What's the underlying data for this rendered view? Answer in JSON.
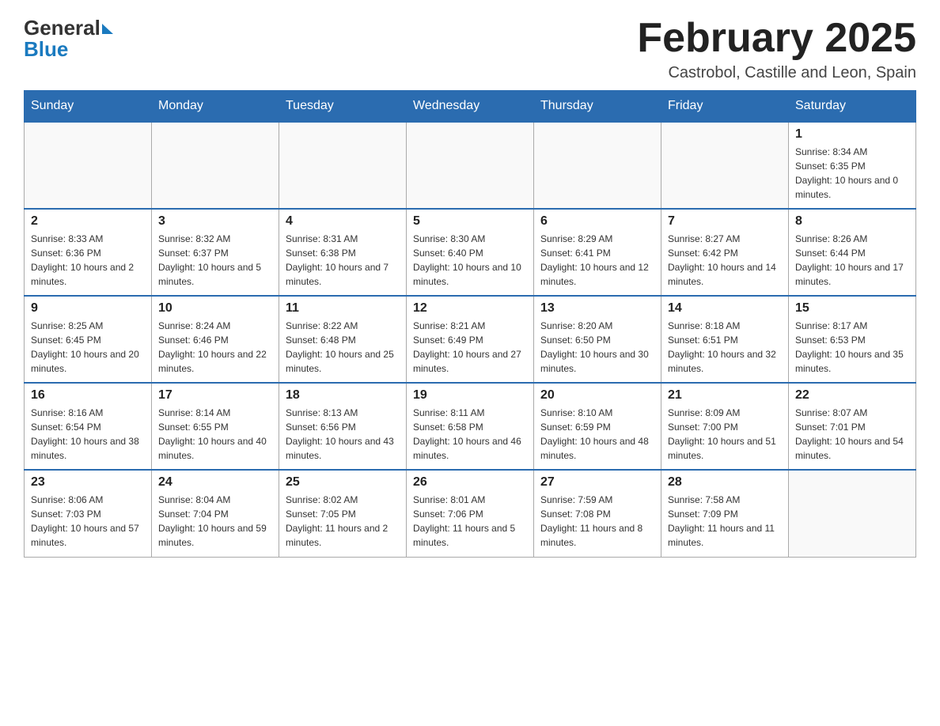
{
  "header": {
    "logo_text_general": "General",
    "logo_text_blue": "Blue",
    "month_title": "February 2025",
    "location": "Castrobol, Castille and Leon, Spain"
  },
  "weekdays": [
    "Sunday",
    "Monday",
    "Tuesday",
    "Wednesday",
    "Thursday",
    "Friday",
    "Saturday"
  ],
  "weeks": [
    [
      {
        "day": "",
        "info": ""
      },
      {
        "day": "",
        "info": ""
      },
      {
        "day": "",
        "info": ""
      },
      {
        "day": "",
        "info": ""
      },
      {
        "day": "",
        "info": ""
      },
      {
        "day": "",
        "info": ""
      },
      {
        "day": "1",
        "info": "Sunrise: 8:34 AM\nSunset: 6:35 PM\nDaylight: 10 hours and 0 minutes."
      }
    ],
    [
      {
        "day": "2",
        "info": "Sunrise: 8:33 AM\nSunset: 6:36 PM\nDaylight: 10 hours and 2 minutes."
      },
      {
        "day": "3",
        "info": "Sunrise: 8:32 AM\nSunset: 6:37 PM\nDaylight: 10 hours and 5 minutes."
      },
      {
        "day": "4",
        "info": "Sunrise: 8:31 AM\nSunset: 6:38 PM\nDaylight: 10 hours and 7 minutes."
      },
      {
        "day": "5",
        "info": "Sunrise: 8:30 AM\nSunset: 6:40 PM\nDaylight: 10 hours and 10 minutes."
      },
      {
        "day": "6",
        "info": "Sunrise: 8:29 AM\nSunset: 6:41 PM\nDaylight: 10 hours and 12 minutes."
      },
      {
        "day": "7",
        "info": "Sunrise: 8:27 AM\nSunset: 6:42 PM\nDaylight: 10 hours and 14 minutes."
      },
      {
        "day": "8",
        "info": "Sunrise: 8:26 AM\nSunset: 6:44 PM\nDaylight: 10 hours and 17 minutes."
      }
    ],
    [
      {
        "day": "9",
        "info": "Sunrise: 8:25 AM\nSunset: 6:45 PM\nDaylight: 10 hours and 20 minutes."
      },
      {
        "day": "10",
        "info": "Sunrise: 8:24 AM\nSunset: 6:46 PM\nDaylight: 10 hours and 22 minutes."
      },
      {
        "day": "11",
        "info": "Sunrise: 8:22 AM\nSunset: 6:48 PM\nDaylight: 10 hours and 25 minutes."
      },
      {
        "day": "12",
        "info": "Sunrise: 8:21 AM\nSunset: 6:49 PM\nDaylight: 10 hours and 27 minutes."
      },
      {
        "day": "13",
        "info": "Sunrise: 8:20 AM\nSunset: 6:50 PM\nDaylight: 10 hours and 30 minutes."
      },
      {
        "day": "14",
        "info": "Sunrise: 8:18 AM\nSunset: 6:51 PM\nDaylight: 10 hours and 32 minutes."
      },
      {
        "day": "15",
        "info": "Sunrise: 8:17 AM\nSunset: 6:53 PM\nDaylight: 10 hours and 35 minutes."
      }
    ],
    [
      {
        "day": "16",
        "info": "Sunrise: 8:16 AM\nSunset: 6:54 PM\nDaylight: 10 hours and 38 minutes."
      },
      {
        "day": "17",
        "info": "Sunrise: 8:14 AM\nSunset: 6:55 PM\nDaylight: 10 hours and 40 minutes."
      },
      {
        "day": "18",
        "info": "Sunrise: 8:13 AM\nSunset: 6:56 PM\nDaylight: 10 hours and 43 minutes."
      },
      {
        "day": "19",
        "info": "Sunrise: 8:11 AM\nSunset: 6:58 PM\nDaylight: 10 hours and 46 minutes."
      },
      {
        "day": "20",
        "info": "Sunrise: 8:10 AM\nSunset: 6:59 PM\nDaylight: 10 hours and 48 minutes."
      },
      {
        "day": "21",
        "info": "Sunrise: 8:09 AM\nSunset: 7:00 PM\nDaylight: 10 hours and 51 minutes."
      },
      {
        "day": "22",
        "info": "Sunrise: 8:07 AM\nSunset: 7:01 PM\nDaylight: 10 hours and 54 minutes."
      }
    ],
    [
      {
        "day": "23",
        "info": "Sunrise: 8:06 AM\nSunset: 7:03 PM\nDaylight: 10 hours and 57 minutes."
      },
      {
        "day": "24",
        "info": "Sunrise: 8:04 AM\nSunset: 7:04 PM\nDaylight: 10 hours and 59 minutes."
      },
      {
        "day": "25",
        "info": "Sunrise: 8:02 AM\nSunset: 7:05 PM\nDaylight: 11 hours and 2 minutes."
      },
      {
        "day": "26",
        "info": "Sunrise: 8:01 AM\nSunset: 7:06 PM\nDaylight: 11 hours and 5 minutes."
      },
      {
        "day": "27",
        "info": "Sunrise: 7:59 AM\nSunset: 7:08 PM\nDaylight: 11 hours and 8 minutes."
      },
      {
        "day": "28",
        "info": "Sunrise: 7:58 AM\nSunset: 7:09 PM\nDaylight: 11 hours and 11 minutes."
      },
      {
        "day": "",
        "info": ""
      }
    ]
  ]
}
